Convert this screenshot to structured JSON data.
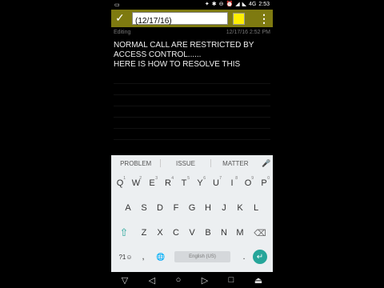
{
  "status": {
    "left_icons": [
      "▭"
    ],
    "right_icons": [
      "✦",
      "✱",
      "⊖",
      "⏰",
      "◢",
      "◣"
    ],
    "signal": "4G",
    "time": "2:53"
  },
  "toolbar": {
    "confirm_icon": "✓",
    "title_value": "(12/17/16)",
    "color": "#ffee00",
    "menu_icon": "⋮"
  },
  "note": {
    "status": "Editing",
    "timestamp": "12/17/16 2:52 PM",
    "lines": [
      "NORMAL CALL ARE RESTRICTED BY",
      "ACCESS CONTROL......",
      "HERE IS HOW TO RESOLVE THIS"
    ]
  },
  "keyboard": {
    "suggestions": [
      "PROBLEM",
      "ISSUE",
      "MATTER"
    ],
    "mic_icon": "🎤",
    "row1": [
      {
        "k": "Q",
        "n": "1"
      },
      {
        "k": "W",
        "n": "2"
      },
      {
        "k": "E",
        "n": "3"
      },
      {
        "k": "R",
        "n": "4"
      },
      {
        "k": "T",
        "n": "5"
      },
      {
        "k": "Y",
        "n": "6"
      },
      {
        "k": "U",
        "n": "7"
      },
      {
        "k": "I",
        "n": "8"
      },
      {
        "k": "O",
        "n": "9"
      },
      {
        "k": "P",
        "n": "0"
      }
    ],
    "row2": [
      "A",
      "S",
      "D",
      "F",
      "G",
      "H",
      "J",
      "K",
      "L"
    ],
    "row3": [
      "Z",
      "X",
      "C",
      "V",
      "B",
      "N",
      "M"
    ],
    "shift_icon": "⇧",
    "backspace_icon": "⌫",
    "symbols_label": "?1☺",
    "comma": ",",
    "globe_icon": "🌐",
    "space_label": "English (US)",
    "period": ".",
    "enter_icon": "↵"
  },
  "navbar": {
    "down": "▽",
    "back": "◁",
    "home": "○",
    "forward": "▷",
    "recents": "□",
    "pull": "⏏"
  }
}
